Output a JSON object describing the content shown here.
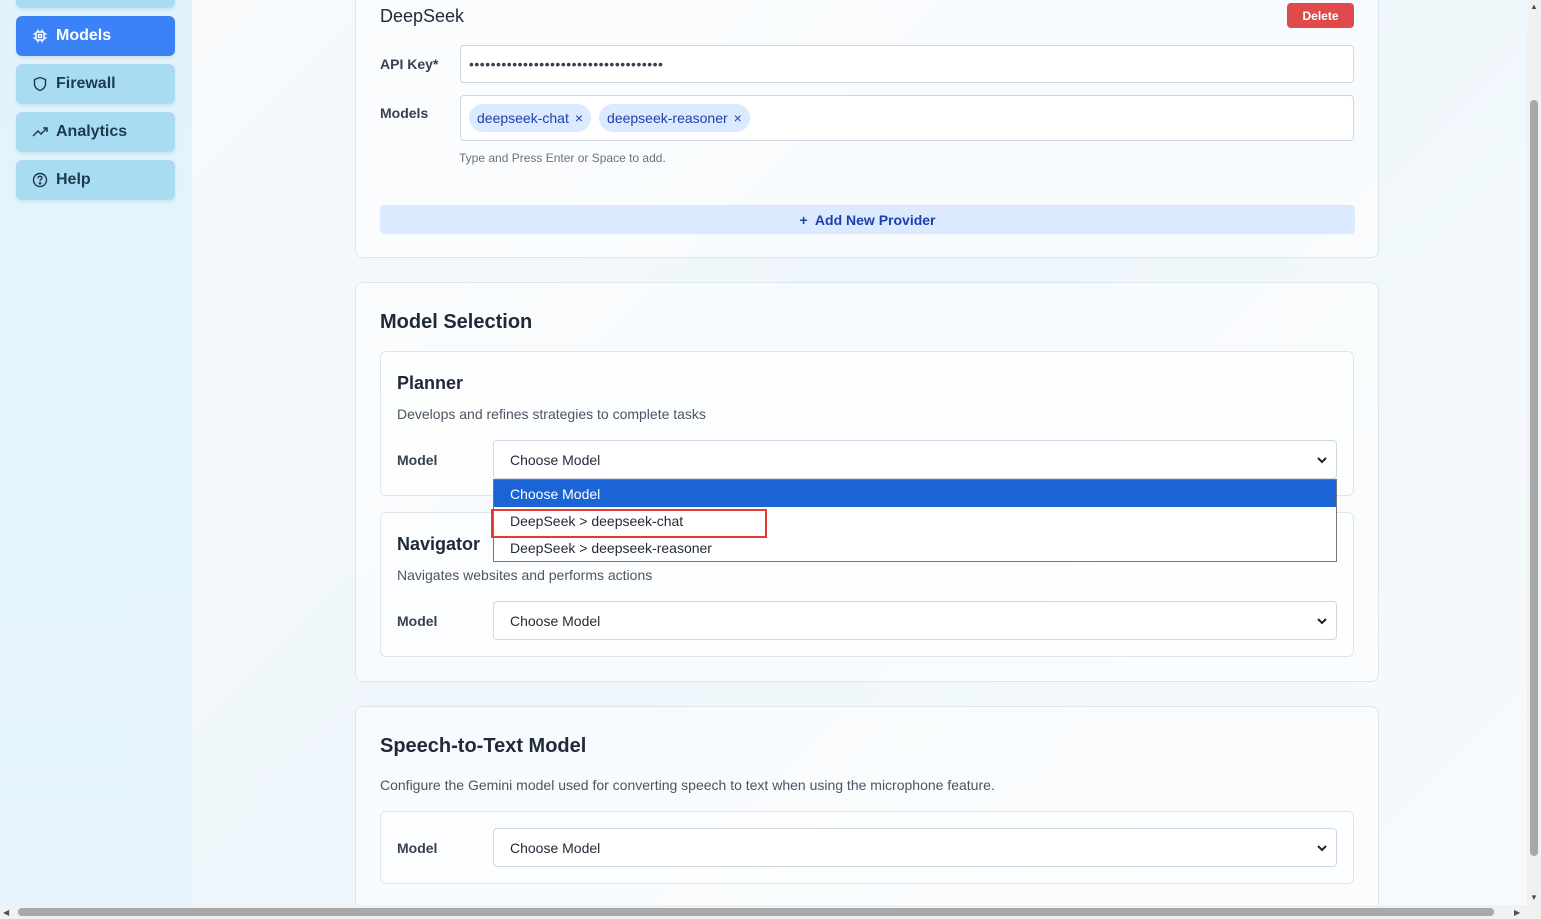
{
  "sidebar": {
    "items": [
      {
        "label": "Models",
        "icon": "chip-icon",
        "active": true
      },
      {
        "label": "Firewall",
        "icon": "shield-icon",
        "active": false
      },
      {
        "label": "Analytics",
        "icon": "trend-icon",
        "active": false
      },
      {
        "label": "Help",
        "icon": "help-circle-icon",
        "active": false
      }
    ]
  },
  "provider": {
    "name": "DeepSeek",
    "delete_label": "Delete",
    "api_key_label": "API Key*",
    "api_key_value": "••••••••••••••••••••••••••••••••••••",
    "models_label": "Models",
    "tags": [
      "deepseek-chat",
      "deepseek-reasoner"
    ],
    "tag_remove": "×",
    "hint": "Type and Press Enter or Space to add.",
    "add_provider_label": "+  Add New Provider"
  },
  "model_selection": {
    "title": "Model Selection",
    "planner": {
      "title": "Planner",
      "desc": "Develops and refines strategies to complete tasks",
      "model_label": "Model",
      "selected": "Choose Model"
    },
    "navigator": {
      "title": "Navigator",
      "desc": "Navigates websites and performs actions",
      "model_label": "Model",
      "selected": "Choose Model"
    },
    "dropdown_options": [
      "Choose Model",
      "DeepSeek > deepseek-chat",
      "DeepSeek > deepseek-reasoner"
    ]
  },
  "speech_to_text": {
    "title": "Speech-to-Text Model",
    "desc": "Configure the Gemini model used for converting speech to text when using the microphone feature.",
    "model_label": "Model",
    "selected": "Choose Model"
  },
  "colors": {
    "accent": "#3b82f6",
    "delete": "#e04a4a",
    "dropdown_selected": "#1a64d6",
    "highlight": "#e53935"
  }
}
